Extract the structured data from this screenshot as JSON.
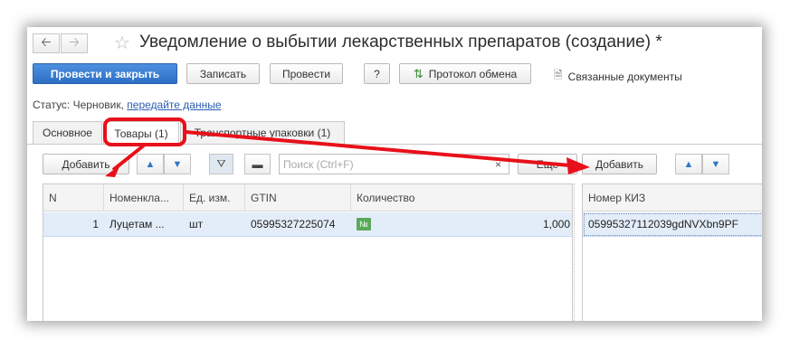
{
  "window": {
    "title": "Уведомление о выбытии лекарственных препаратов (создание) *"
  },
  "nav": {
    "back_icon": "arrow-left-icon",
    "forward_icon": "arrow-right-icon",
    "favorite_icon": "star-icon"
  },
  "toolbar": {
    "post_close_label": "Провести и закрыть",
    "save_label": "Записать",
    "post_label": "Провести",
    "help_label": "?",
    "exchange_log_label": "Протокол обмена",
    "related_docs_label": "Связанные документы"
  },
  "status": {
    "label": "Статус:",
    "value": "Черновик,",
    "link": "передайте данные"
  },
  "tabs": [
    {
      "label": "Основное"
    },
    {
      "label": "Товары (1)"
    },
    {
      "label": "Транспортные упаковки (1)"
    }
  ],
  "goods_toolbar": {
    "add_label": "Добавить",
    "search_placeholder": "Поиск (Ctrl+F)",
    "clear_label": "×",
    "more_label": "Еще"
  },
  "goods_table": {
    "columns": [
      "N",
      "Номенкла...",
      "Ед. изм.",
      "GTIN",
      "Количество"
    ],
    "rows": [
      {
        "n": "1",
        "name": "Луцетам ...",
        "unit": "шт",
        "gtin": "05995327225074",
        "badge": "№",
        "qty": "1,000"
      }
    ]
  },
  "kiz_toolbar": {
    "add_label": "Добавить"
  },
  "kiz_table": {
    "columns": [
      "Номер КИЗ"
    ],
    "rows": [
      {
        "kiz": "05995327112039gdNVXbn9PF"
      }
    ]
  },
  "colors": {
    "primary": "#2d6fc4",
    "selection": "#e3edf9",
    "annotation": "#e8101a",
    "badge": "#5aa85a"
  }
}
